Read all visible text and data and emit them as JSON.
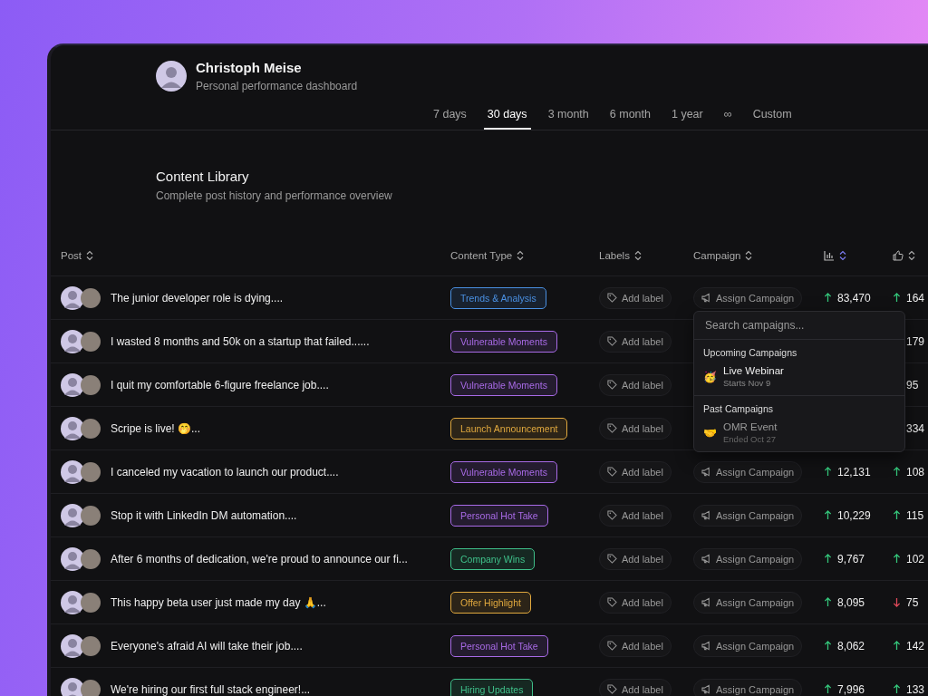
{
  "profile": {
    "name": "Christoph Meise",
    "subtitle": "Personal performance dashboard"
  },
  "ranges": [
    {
      "label": "7 days",
      "selected": false
    },
    {
      "label": "30 days",
      "selected": true
    },
    {
      "label": "3 month",
      "selected": false
    },
    {
      "label": "6 month",
      "selected": false
    },
    {
      "label": "1 year",
      "selected": false
    },
    {
      "label": "∞",
      "selected": false
    },
    {
      "label": "Custom",
      "selected": false
    }
  ],
  "library": {
    "title": "Content Library",
    "subtitle": "Complete post history and performance overview"
  },
  "table": {
    "columns": [
      {
        "kind": "text",
        "label": "Post"
      },
      {
        "kind": "text",
        "label": "Content Type"
      },
      {
        "kind": "text",
        "label": "Labels"
      },
      {
        "kind": "text",
        "label": "Campaign"
      },
      {
        "kind": "views"
      },
      {
        "kind": "likes"
      }
    ],
    "rows": [
      {
        "post": "The junior developer role is dying....",
        "type": {
          "label": "Trends & Analysis",
          "color": "#4a90e2"
        },
        "label": "Add label",
        "campaign": "Assign Campaign",
        "views": {
          "value": "83,470",
          "rising": true
        },
        "likes": {
          "value": "164",
          "rising": true
        }
      },
      {
        "post": "I wasted 8 months and 50k on a startup that failed......",
        "type": {
          "label": "Vulnerable Moments",
          "color": "#a86ae6"
        },
        "label": "Add label",
        "likes": {
          "value": "179"
        }
      },
      {
        "post": "I quit my comfortable 6-figure freelance job....",
        "type": {
          "label": "Vulnerable Moments",
          "color": "#a86ae6"
        },
        "label": "Add label",
        "likes": {
          "value": "95"
        }
      },
      {
        "post": "Scripe is live! 🤭...",
        "type": {
          "label": "Launch Announcement",
          "color": "#e0a83e"
        },
        "label": "Add label",
        "likes": {
          "value": "334"
        }
      },
      {
        "post": "I canceled my vacation to launch our product....",
        "type": {
          "label": "Vulnerable Moments",
          "color": "#a86ae6"
        },
        "label": "Add label",
        "campaign": "Assign Campaign",
        "views": {
          "value": "12,131",
          "rising": true
        },
        "likes": {
          "value": "108",
          "rising": true
        }
      },
      {
        "post": "Stop it with LinkedIn DM automation....",
        "type": {
          "label": "Personal Hot Take",
          "color": "#a86ae6"
        },
        "label": "Add label",
        "campaign": "Assign Campaign",
        "views": {
          "value": "10,229",
          "rising": true
        },
        "likes": {
          "value": "115",
          "rising": true
        }
      },
      {
        "post": "After 6 months of dedication, we're proud to announce our fi...",
        "type": {
          "label": "Company Wins",
          "color": "#3fc08a"
        },
        "label": "Add label",
        "campaign": "Assign Campaign",
        "views": {
          "value": "9,767",
          "rising": true
        },
        "likes": {
          "value": "102",
          "rising": true
        }
      },
      {
        "post": "This happy beta user just made my day 🙏...",
        "type": {
          "label": "Offer Highlight",
          "color": "#e0a83e"
        },
        "label": "Add label",
        "campaign": "Assign Campaign",
        "views": {
          "value": "8,095",
          "rising": true
        },
        "likes": {
          "value": "75",
          "rising": false
        }
      },
      {
        "post": "Everyone's afraid AI will take their job....",
        "type": {
          "label": "Personal Hot Take",
          "color": "#a86ae6"
        },
        "label": "Add label",
        "campaign": "Assign Campaign",
        "views": {
          "value": "8,062",
          "rising": true
        },
        "likes": {
          "value": "142",
          "rising": true
        }
      },
      {
        "post": "We're hiring our first full stack engineer!...",
        "type": {
          "label": "Hiring Updates",
          "color": "#3fc08a"
        },
        "label": "Add label",
        "campaign": "Assign Campaign",
        "views": {
          "value": "7,996",
          "rising": true
        },
        "likes": {
          "value": "133",
          "rising": true
        }
      }
    ]
  },
  "campaign_menu": {
    "placeholder": "Search campaigns...",
    "groups": [
      {
        "title": "Upcoming Campaigns",
        "items": [
          {
            "icon": "🥳",
            "name": "Live Webinar",
            "date": "Starts Nov 9",
            "past": false
          }
        ]
      },
      {
        "title": "Past Campaigns",
        "items": [
          {
            "icon": "🤝",
            "name": "OMR Event",
            "date": "Ended Oct 27",
            "past": true
          }
        ]
      }
    ]
  }
}
